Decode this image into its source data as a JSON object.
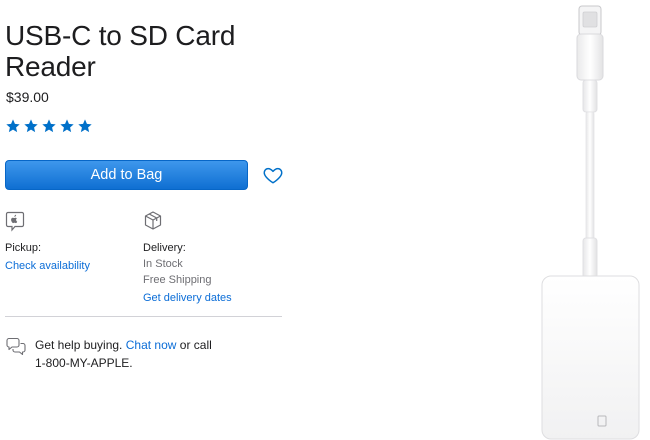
{
  "product": {
    "title": "USB-C to SD Card Reader",
    "price": "$39.00",
    "rating": 5,
    "rating_color": "#0070c9"
  },
  "actions": {
    "add_to_bag": "Add to Bag",
    "favorite_icon": "heart-icon"
  },
  "pickup": {
    "icon": "apple-store-icon",
    "label": "Pickup:",
    "link": "Check availability"
  },
  "delivery": {
    "icon": "box-icon",
    "label": "Delivery:",
    "stock": "In Stock",
    "shipping": "Free Shipping",
    "link": "Get delivery dates"
  },
  "help": {
    "icon": "chat-bubbles-icon",
    "text_before": "Get help buying.",
    "chat_link": "Chat now",
    "text_after": "or call",
    "phone": "1-800-MY-APPLE."
  },
  "colors": {
    "accent": "#0070c9",
    "link": "#0b6dd7",
    "text": "#1d1d1f"
  }
}
